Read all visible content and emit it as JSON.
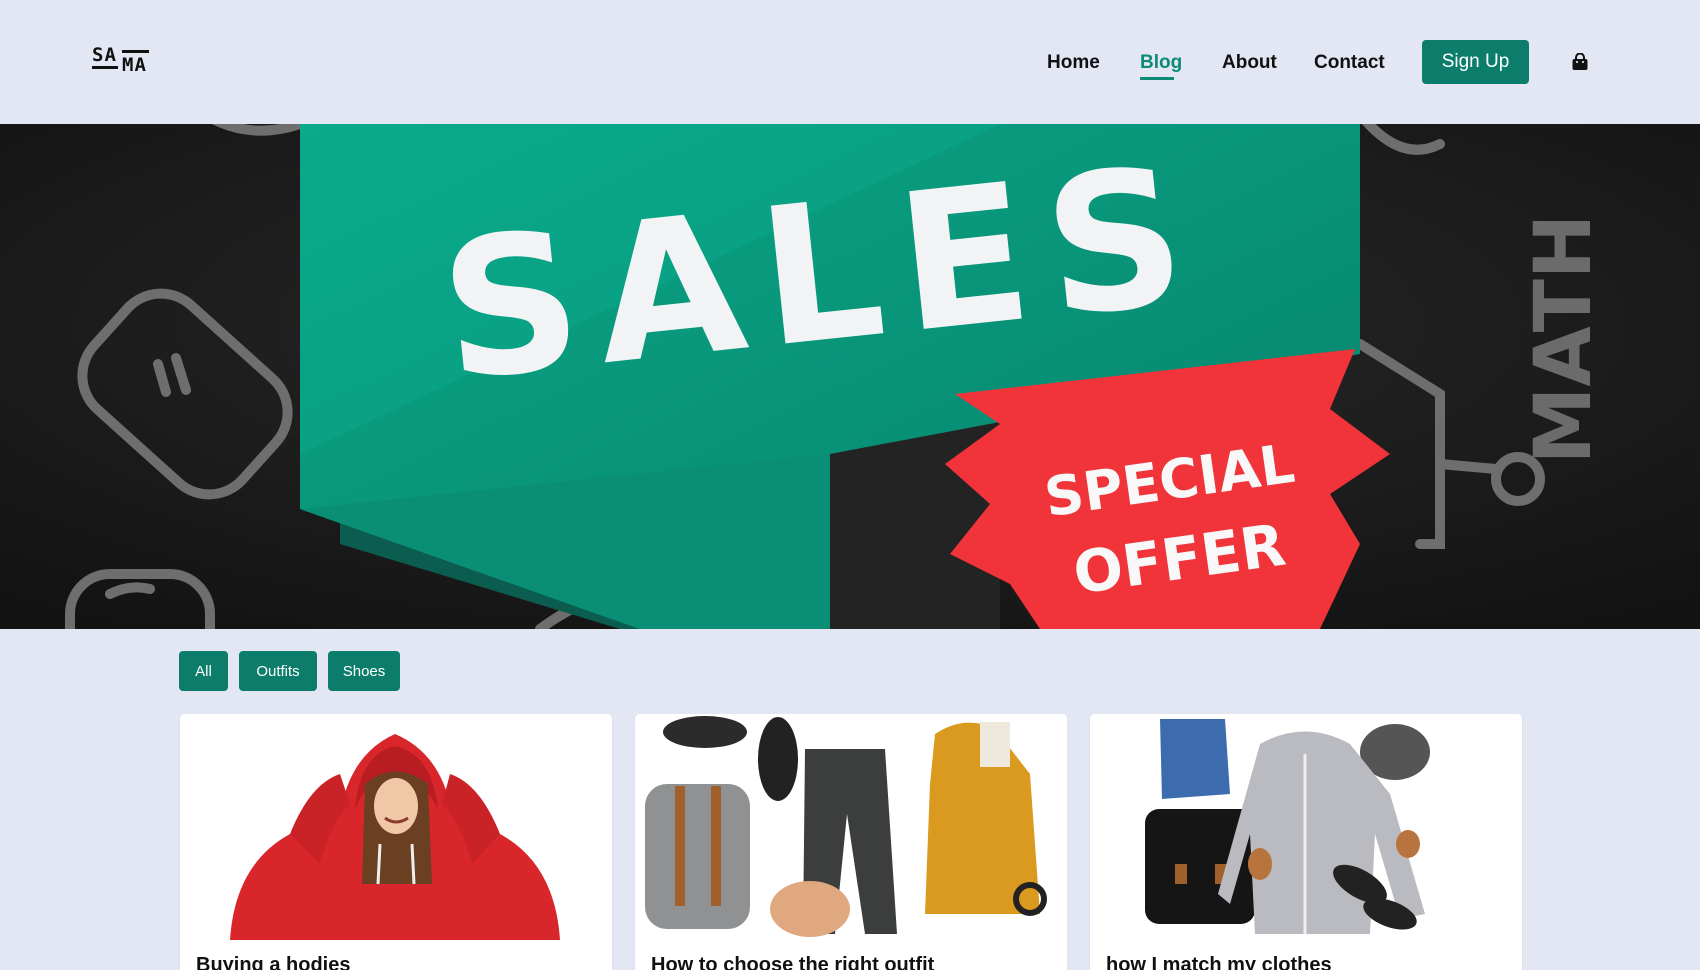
{
  "brand": {
    "logo_line1": "SA",
    "logo_line2": "MA"
  },
  "nav": {
    "items": [
      {
        "label": "Home"
      },
      {
        "label": "Blog",
        "active": true
      },
      {
        "label": "About"
      },
      {
        "label": "Contact"
      }
    ],
    "signup_label": "Sign Up",
    "cart_icon": "shopping-bag-icon"
  },
  "hero": {
    "headline": "SALES",
    "badge_line1": "SPECIAL",
    "badge_line2": "OFFER",
    "side_text": "MATH"
  },
  "filters": [
    {
      "label": "All"
    },
    {
      "label": "Outfits"
    },
    {
      "label": "Shoes"
    }
  ],
  "cards": [
    {
      "title": "Buying a hodies"
    },
    {
      "title": "How to choose the right outfit"
    },
    {
      "title": "how I match my clothes"
    }
  ],
  "colors": {
    "accent": "#0d7d6b",
    "page_bg": "#e3e7f3",
    "banner_green": "#0a9a80",
    "badge_red": "#f0343a"
  }
}
